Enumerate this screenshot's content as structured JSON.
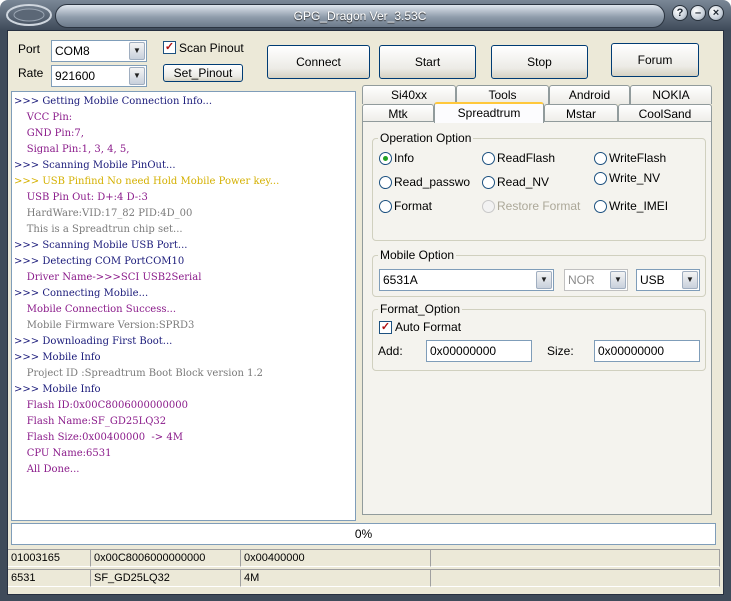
{
  "window": {
    "title": "GPG_Dragon  Ver_3.53C",
    "controls": [
      "help-icon",
      "minimize-icon",
      "close-icon"
    ]
  },
  "connection": {
    "port_label": "Port",
    "port_value": "COM8",
    "rate_label": "Rate",
    "rate_value": "921600",
    "scan_pinout_label": "Scan Pinout",
    "scan_pinout_checked": true,
    "set_pinout_label": "Set_Pinout"
  },
  "toolbar": {
    "connect": "Connect",
    "start": "Start",
    "stop": "Stop",
    "forum": "Forum"
  },
  "log": [
    {
      "text": ">>> Getting Mobile Connection Info...",
      "color": "navy"
    },
    {
      "text": "    VCC Pin:",
      "color": "purple"
    },
    {
      "text": "    GND Pin:7,",
      "color": "purple"
    },
    {
      "text": "    Signal Pin:1, 3, 4, 5,",
      "color": "purple"
    },
    {
      "text": ">>> Scanning Mobile PinOut...",
      "color": "navy"
    },
    {
      "text": ">>> USB Pinfind No need Hold Mobile Power key...",
      "color": "yellow"
    },
    {
      "text": "    USB Pin Out: D+:4 D-:3",
      "color": "purple"
    },
    {
      "text": "    HardWare:VID:17_82 PID:4D_00",
      "color": "gray"
    },
    {
      "text": "    This is a Spreadtrun chip set...",
      "color": "gray"
    },
    {
      "text": ">>> Scanning Mobile USB Port...",
      "color": "navy"
    },
    {
      "text": ">>> Detecting COM PortCOM10",
      "color": "navy"
    },
    {
      "text": "    Driver Name->>>SCI USB2Serial",
      "color": "purple"
    },
    {
      "text": ">>> Connecting Mobile...",
      "color": "navy"
    },
    {
      "text": "    Mobile Connection Success...",
      "color": "purple"
    },
    {
      "text": "    Mobile Firmware Version:SPRD3",
      "color": "gray"
    },
    {
      "text": ">>> Downloading First Boot...",
      "color": "navy"
    },
    {
      "text": ">>> Mobile Info",
      "color": "navy"
    },
    {
      "text": "    Project ID :Spreadtrum Boot Block version 1.2",
      "color": "gray"
    },
    {
      "text": ">>> Mobile Info",
      "color": "navy"
    },
    {
      "text": "    Flash ID:0x00C8006000000000",
      "color": "purple"
    },
    {
      "text": "    Flash Name:SF_GD25LQ32",
      "color": "purple"
    },
    {
      "text": "    Flash Size:0x00400000  -> 4M",
      "color": "purple"
    },
    {
      "text": "    CPU Name:6531",
      "color": "purple"
    },
    {
      "text": "    All Done...",
      "color": "purple"
    }
  ],
  "tabs": {
    "row1": [
      "Si40xx",
      "Tools",
      "Android",
      "NOKIA"
    ],
    "row2": [
      "Mtk",
      "Spreadtrum",
      "Mstar",
      "CoolSand"
    ],
    "active": "Spreadtrum"
  },
  "operation": {
    "title": "Operation Option",
    "options": [
      {
        "label": "Info",
        "selected": true,
        "disabled": false
      },
      {
        "label": "ReadFlash",
        "selected": false,
        "disabled": false
      },
      {
        "label": "WriteFlash",
        "selected": false,
        "disabled": false
      },
      {
        "label": "Read_passwo",
        "selected": false,
        "disabled": false
      },
      {
        "label": "Read_NV",
        "selected": false,
        "disabled": false
      },
      {
        "label": "Write_NV",
        "selected": false,
        "disabled": false
      },
      {
        "label": "Format",
        "selected": false,
        "disabled": false
      },
      {
        "label": "Restore Format",
        "selected": false,
        "disabled": true
      },
      {
        "label": "Write_IMEI",
        "selected": false,
        "disabled": false
      }
    ]
  },
  "mobile": {
    "title": "Mobile Option",
    "model": "6531A",
    "flash_type": "NOR",
    "interface": "USB"
  },
  "format": {
    "title": "Format_Option",
    "auto_format_label": "Auto Format",
    "auto_format_checked": true,
    "add_label": "Add:",
    "add_value": "0x00000000",
    "size_label": "Size:",
    "size_value": "0x00000000"
  },
  "progress": {
    "percent": 0,
    "text": "0%"
  },
  "status": {
    "row1": [
      "01003165",
      "0x00C8006000000000",
      "0x00400000",
      ""
    ],
    "row2": [
      "6531",
      "SF_GD25LQ32",
      "4M",
      ""
    ]
  },
  "colors": {
    "navy": "#1a1a7a",
    "purple": "#8a1a8a",
    "yellow": "#d4b000",
    "gray": "#7a7a7a",
    "tab_accent": "#ffc83c",
    "radio_dot": "#21a121"
  }
}
